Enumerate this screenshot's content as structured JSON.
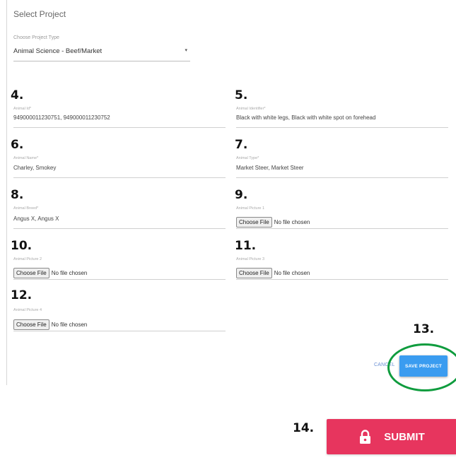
{
  "header": {
    "title": "Select Project",
    "project_type_label": "Choose Project Type",
    "project_type_value": "Animal Science - Beef/Market",
    "dropdown_arrow": "▾"
  },
  "fields": {
    "animal_id": {
      "number": "4.",
      "label": "Animal Id*",
      "value": "949000011230751, 949000011230752"
    },
    "animal_identifier": {
      "number": "5.",
      "label": "Animal Identifier*",
      "value": "Black with white legs, Black with white spot on forehead"
    },
    "animal_name": {
      "number": "6.",
      "label": "Animal Name*",
      "value": "Charley, Smokey"
    },
    "animal_type": {
      "number": "7.",
      "label": "Animal Type*",
      "value": "Market Steer, Market Steer"
    },
    "animal_breed": {
      "number": "8.",
      "label": "Animal Breed*",
      "value": "Angus X, Angus X"
    },
    "picture_1": {
      "number": "9.",
      "label": "Animal Picture 1",
      "button": "Choose File",
      "status": "No file chosen"
    },
    "picture_2": {
      "number": "10.",
      "label": "Animal Picture 2",
      "button": "Choose File",
      "status": "No file chosen"
    },
    "picture_3": {
      "number": "11.",
      "label": "Animal Picture 3",
      "button": "Choose File",
      "status": "No file chosen"
    },
    "picture_4": {
      "number": "12.",
      "label": "Animal Picture 4",
      "button": "Choose File",
      "status": "No file chosen"
    }
  },
  "actions": {
    "save_number": "13.",
    "cancel_label": "CANCEL",
    "save_label": "SAVE PROJECT",
    "submit_number": "14.",
    "submit_label": "SUBMIT",
    "highlight_color": "#0f9c3e",
    "submit_color": "#e7355e",
    "save_color": "#3a9cf0"
  }
}
